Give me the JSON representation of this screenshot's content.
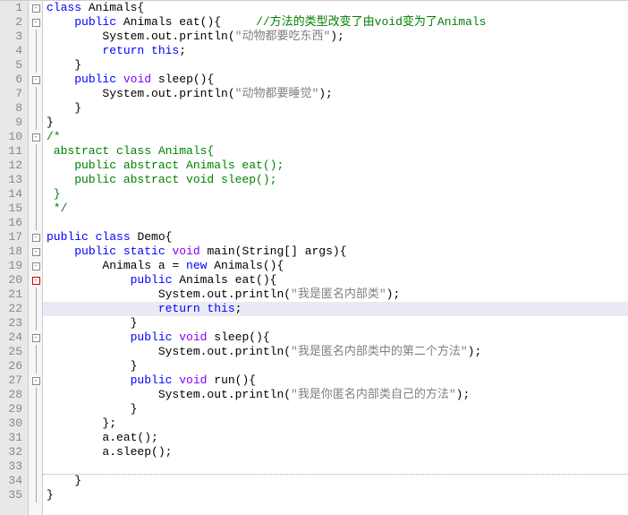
{
  "lines": [
    {
      "n": 1,
      "fold": "minus",
      "t": [
        {
          "c": "kw",
          "s": "class"
        },
        {
          "s": " Animals{"
        }
      ]
    },
    {
      "n": 2,
      "fold": "minus",
      "t": [
        {
          "s": "    "
        },
        {
          "c": "kw",
          "s": "public"
        },
        {
          "s": " Animals eat(){     "
        },
        {
          "c": "cmt",
          "s": "//方法的类型改变了由void变为了Animals"
        }
      ]
    },
    {
      "n": 3,
      "t": [
        {
          "s": "        System.out.println("
        },
        {
          "c": "str",
          "s": "\"动物都要吃东西\""
        },
        {
          "s": ");"
        }
      ]
    },
    {
      "n": 4,
      "t": [
        {
          "s": "        "
        },
        {
          "c": "kw",
          "s": "return this"
        },
        {
          "s": ";"
        }
      ]
    },
    {
      "n": 5,
      "t": [
        {
          "s": "    }"
        }
      ]
    },
    {
      "n": 6,
      "fold": "minus",
      "t": [
        {
          "s": "    "
        },
        {
          "c": "kw",
          "s": "public"
        },
        {
          "s": " "
        },
        {
          "c": "type",
          "s": "void"
        },
        {
          "s": " sleep(){"
        }
      ]
    },
    {
      "n": 7,
      "t": [
        {
          "s": "        System.out.println("
        },
        {
          "c": "str",
          "s": "\"动物都要睡觉\""
        },
        {
          "s": ");"
        }
      ]
    },
    {
      "n": 8,
      "t": [
        {
          "s": "    }"
        }
      ]
    },
    {
      "n": 9,
      "t": [
        {
          "s": "}"
        }
      ]
    },
    {
      "n": 10,
      "fold": "minus",
      "t": [
        {
          "c": "cmt",
          "s": "/*"
        }
      ]
    },
    {
      "n": 11,
      "t": [
        {
          "c": "cmt",
          "s": " abstract class Animals{"
        }
      ]
    },
    {
      "n": 12,
      "t": [
        {
          "c": "cmt",
          "s": "    public abstract Animals eat();"
        }
      ]
    },
    {
      "n": 13,
      "t": [
        {
          "c": "cmt",
          "s": "    public abstract void sleep();"
        }
      ]
    },
    {
      "n": 14,
      "t": [
        {
          "c": "cmt",
          "s": " }"
        }
      ]
    },
    {
      "n": 15,
      "t": [
        {
          "c": "cmt",
          "s": " */"
        }
      ]
    },
    {
      "n": 16,
      "t": []
    },
    {
      "n": 17,
      "fold": "minus",
      "t": [
        {
          "c": "kw",
          "s": "public"
        },
        {
          "s": " "
        },
        {
          "c": "kw",
          "s": "class"
        },
        {
          "s": " Demo{"
        }
      ]
    },
    {
      "n": 18,
      "fold": "minus",
      "t": [
        {
          "s": "    "
        },
        {
          "c": "kw",
          "s": "public static"
        },
        {
          "s": " "
        },
        {
          "c": "type",
          "s": "void"
        },
        {
          "s": " main(String[] args){"
        }
      ]
    },
    {
      "n": 19,
      "fold": "minus",
      "t": [
        {
          "s": "        Animals a = "
        },
        {
          "c": "kw",
          "s": "new"
        },
        {
          "s": " Animals(){"
        }
      ]
    },
    {
      "n": 20,
      "fold": "minus-red",
      "t": [
        {
          "s": "            "
        },
        {
          "c": "kw",
          "s": "public"
        },
        {
          "s": " Animals eat(){"
        }
      ]
    },
    {
      "n": 21,
      "t": [
        {
          "s": "                System.out.println("
        },
        {
          "c": "str",
          "s": "\"我是匿名内部类\""
        },
        {
          "s": ");"
        }
      ]
    },
    {
      "n": 22,
      "hl": true,
      "t": [
        {
          "s": "                "
        },
        {
          "c": "kw",
          "s": "return this"
        },
        {
          "s": ";"
        }
      ]
    },
    {
      "n": 23,
      "t": [
        {
          "s": "            }"
        }
      ]
    },
    {
      "n": 24,
      "fold": "minus",
      "t": [
        {
          "s": "            "
        },
        {
          "c": "kw",
          "s": "public"
        },
        {
          "s": " "
        },
        {
          "c": "type",
          "s": "void"
        },
        {
          "s": " sleep(){"
        }
      ]
    },
    {
      "n": 25,
      "t": [
        {
          "s": "                System.out.println("
        },
        {
          "c": "str",
          "s": "\"我是匿名内部类中的第二个方法\""
        },
        {
          "s": ");"
        }
      ]
    },
    {
      "n": 26,
      "t": [
        {
          "s": "            }"
        }
      ]
    },
    {
      "n": 27,
      "fold": "minus",
      "t": [
        {
          "s": "            "
        },
        {
          "c": "kw",
          "s": "public"
        },
        {
          "s": " "
        },
        {
          "c": "type",
          "s": "void"
        },
        {
          "s": " run(){"
        }
      ]
    },
    {
      "n": 28,
      "t": [
        {
          "s": "                System.out.println("
        },
        {
          "c": "str",
          "s": "\"我是你匿名内部类自己的方法\""
        },
        {
          "s": ");"
        }
      ]
    },
    {
      "n": 29,
      "t": [
        {
          "s": "            }"
        }
      ]
    },
    {
      "n": 30,
      "t": [
        {
          "s": "        };"
        }
      ]
    },
    {
      "n": 31,
      "t": [
        {
          "s": "        a.eat();"
        }
      ]
    },
    {
      "n": 32,
      "t": [
        {
          "s": "        a.sleep();"
        }
      ]
    },
    {
      "n": 33,
      "t": []
    },
    {
      "n": 34,
      "t": [
        {
          "s": "    }"
        }
      ],
      "dot": true
    },
    {
      "n": 35,
      "t": [
        {
          "s": "}"
        }
      ]
    }
  ]
}
